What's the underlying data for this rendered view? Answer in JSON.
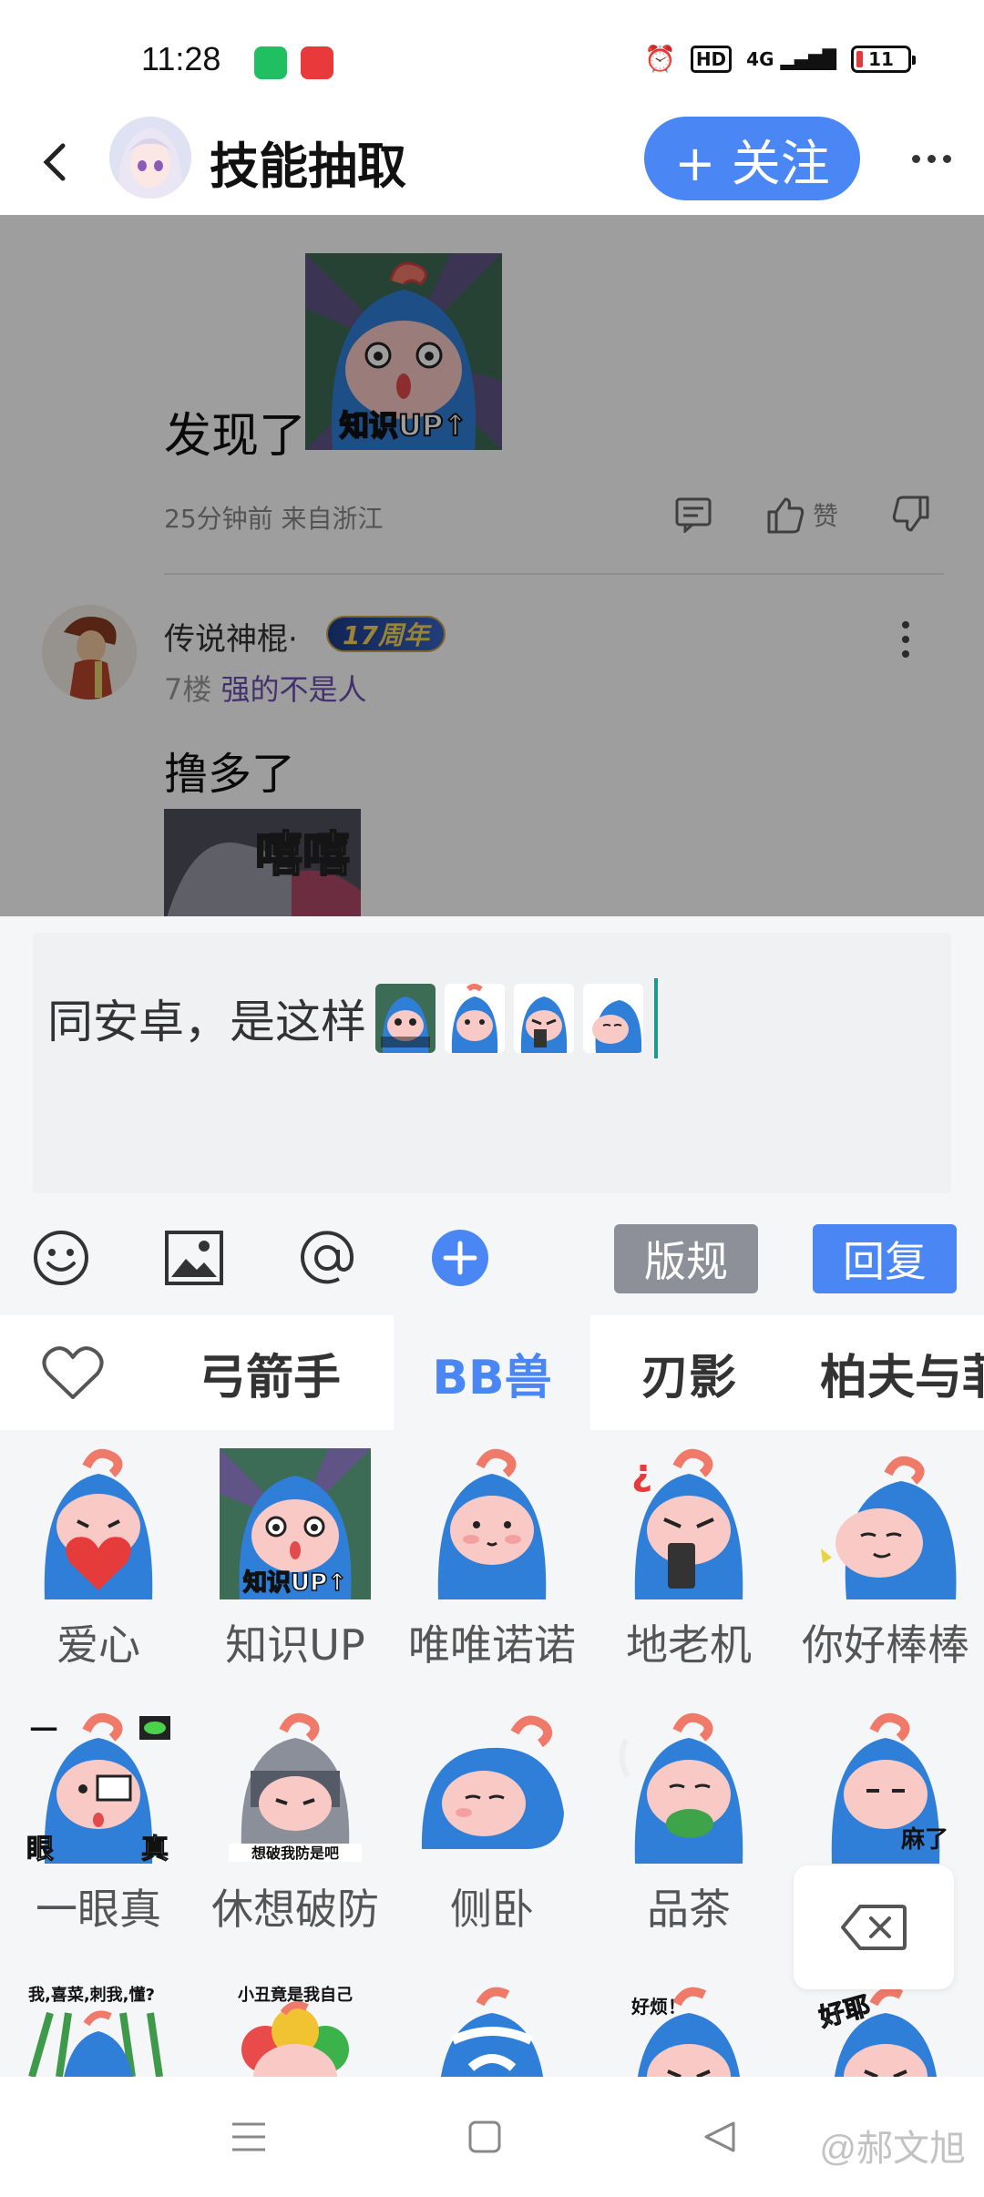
{
  "status_bar": {
    "time": "11:28",
    "hd": "HD",
    "network": "4G",
    "battery": "11"
  },
  "header": {
    "title": "技能抽取",
    "follow_label": "+ 关注"
  },
  "post": {
    "text": "发现了",
    "meta": "25分钟前 来自浙江",
    "like_label": "赞"
  },
  "comment": {
    "name": "传说神棍·",
    "badge": "17周年",
    "floor": "7楼",
    "title": "强的不是人",
    "text": "撸多了",
    "thumb_label": "嘻嘻"
  },
  "reply": {
    "input_text": "同安卓，是这样",
    "rule_label": "版规",
    "reply_label": "回复"
  },
  "emoji_tabs": [
    {
      "label": ""
    },
    {
      "label": "弓箭手"
    },
    {
      "label": "BB兽"
    },
    {
      "label": "刃影"
    },
    {
      "label": "柏夫与菲"
    }
  ],
  "emojis": [
    {
      "label": "爱心"
    },
    {
      "label": "知识UP"
    },
    {
      "label": "唯唯诺诺"
    },
    {
      "label": "地老机"
    },
    {
      "label": "你好棒棒"
    },
    {
      "label": "一眼真"
    },
    {
      "label": "休想破防"
    },
    {
      "label": "侧卧"
    },
    {
      "label": "品茶"
    },
    {
      "label": ""
    }
  ],
  "sticker_text": {
    "zhishi": "知识UP↑",
    "maile": "麻了",
    "yi": "一",
    "yan": "眼",
    "zhen": "真",
    "pofang": "想破我防是吧",
    "row3a": "我,喜菜,刺我,懂?",
    "row3b": "小丑竟是我自己",
    "haofan": "好烦！",
    "haoye": "好耶"
  },
  "watermark": "@郝文旭",
  "colors": {
    "accent": "#4b86f5",
    "sticker_blue": "#2f7fd8",
    "sticker_skin": "#f8c9c5",
    "crest": "#f07a6a"
  }
}
